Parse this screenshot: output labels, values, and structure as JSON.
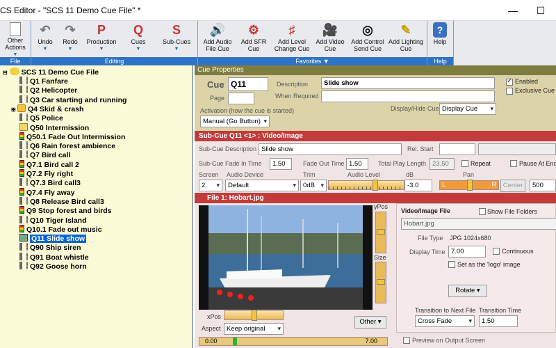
{
  "window": {
    "title": "CS Editor - \"SCS 11 Demo Cue File\" *",
    "min": "—",
    "max": "☐"
  },
  "ribbon": {
    "buttons": [
      {
        "label": "Other\nActions",
        "icon": "document-icon"
      },
      {
        "label": "Undo",
        "icon": "undo-icon"
      },
      {
        "label": "Redo",
        "icon": "redo-icon"
      },
      {
        "label": "Production",
        "icon": "P"
      },
      {
        "label": "Cues",
        "icon": "Q"
      },
      {
        "label": "Sub-Cues",
        "icon": "S"
      },
      {
        "label": "Add Audio\nFile Cue",
        "icon": "speaker-icon"
      },
      {
        "label": "Add SFR\nCue",
        "icon": "sfr-icon"
      },
      {
        "label": "Add Level\nChange Cue",
        "icon": "level-icon"
      },
      {
        "label": "Add Video\nCue",
        "icon": "video-icon"
      },
      {
        "label": "Add Control\nSend Cue",
        "icon": "control-icon"
      },
      {
        "label": "Add Lighting\nCue",
        "icon": "lighting-icon"
      },
      {
        "label": "Help",
        "icon": "help-icon"
      }
    ],
    "groups": {
      "file": "File",
      "editing": "Editing",
      "favorites": "Favorites ▼",
      "help": "Help"
    }
  },
  "tree": {
    "root": "SCS 11 Demo Cue File",
    "items": [
      {
        "label": "Q1 Fanfare",
        "icon": "speaker"
      },
      {
        "label": "Q2 Helicopter",
        "icon": "speaker"
      },
      {
        "label": "Q3 Car starting and running",
        "icon": "speaker"
      },
      {
        "label": "Q4 Skid & crash",
        "icon": "folder"
      },
      {
        "label": "Q5 Police",
        "icon": "speaker"
      },
      {
        "label": "Q50 Intermission",
        "icon": "wait"
      },
      {
        "label": "Q50.1 Fade Out Intermission",
        "icon": "traffic"
      },
      {
        "label": "Q6 Rain forest ambience",
        "icon": "speaker"
      },
      {
        "label": "Q7 Bird call",
        "icon": "speaker"
      },
      {
        "label": "Q7.1 Bird call 2",
        "icon": "traffic"
      },
      {
        "label": "Q7.2 Fly right",
        "icon": "traffic"
      },
      {
        "label": "Q7.3 Bird call3",
        "icon": "speaker"
      },
      {
        "label": "Q7.4 Fly away",
        "icon": "traffic"
      },
      {
        "label": "Q8 Release Bird call3",
        "icon": "speaker"
      },
      {
        "label": "Q9 Stop forest and birds",
        "icon": "traffic"
      },
      {
        "label": "Q10 Tiger Island",
        "icon": "speaker"
      },
      {
        "label": "Q10.1 Fade out music",
        "icon": "traffic"
      },
      {
        "label": "Q11 Slide show",
        "icon": "image"
      },
      {
        "label": "Q90 Ship siren",
        "icon": "speaker"
      },
      {
        "label": "Q91 Boat whistle",
        "icon": "speaker"
      },
      {
        "label": "Q92 Goose horn",
        "icon": "speaker"
      }
    ]
  },
  "cue": {
    "header": "Cue Properties",
    "cue_label": "Cue",
    "cue_value": "Q11",
    "page_label": "Page",
    "desc_label": "Description",
    "desc_value": "Slide show",
    "when_label": "When Required",
    "enabled": "Enabled",
    "exclusive": "Exclusive Cue",
    "activation_label": "Activation (how the cue is started)",
    "activation_value": "Manual (Go Button)",
    "display_label": "Display/Hide Cue",
    "display_value": "Display Cue"
  },
  "subcue": {
    "header": "Sub-Cue Q11 <1> : Video/Image",
    "desc_label": "Sub-Cue Description",
    "desc_value": "Slide show",
    "relstart": "Rel. Start",
    "fadein_label": "Sub-Cue Fade In Time",
    "fadein": "1.50",
    "fadeout_label": "Fade Out Time",
    "fadeout": "1.50",
    "total_label": "Total Play Length",
    "total": "23.50",
    "repeat": "Repeat",
    "pause": "Pause At End",
    "screen_label": "Screen",
    "screen": "2",
    "device_label": "Audio Device",
    "device": "Default",
    "trim_label": "Trim",
    "trim": "0dB",
    "level_label": "Audio Level",
    "db_label": "dB",
    "db": "-3.0",
    "pan_label": "Pan",
    "pan_l": "L",
    "pan_r": "R",
    "center": "Center",
    "pan_val": "500",
    "level_pct": 0.63,
    "pan_pct": 0.5
  },
  "file": {
    "header": "File 1: Hobart.jpg",
    "ypos": "yPos",
    "size": "Size",
    "xpos": "xPos",
    "aspect_label": "Aspect",
    "aspect": "Keep original",
    "other": "Other ▾",
    "start": "0.00",
    "end": "7.00",
    "vf_title": "Video/Image File",
    "show_folders": "Show File Folders",
    "filename": "Hobart.jpg",
    "type_label": "File Type",
    "type": "JPG 1024x680",
    "dtime_label": "Display Time",
    "dtime": "7.00",
    "continuous": "Continuous",
    "logo": "Set as the 'logo' image",
    "rotate": "Rotate ▾",
    "trans_label": "Transition to Next File",
    "trans": "Cross Fade",
    "ttime_label": "Transition Time",
    "ttime": "1.50",
    "preview": "Preview on Output Screen"
  }
}
